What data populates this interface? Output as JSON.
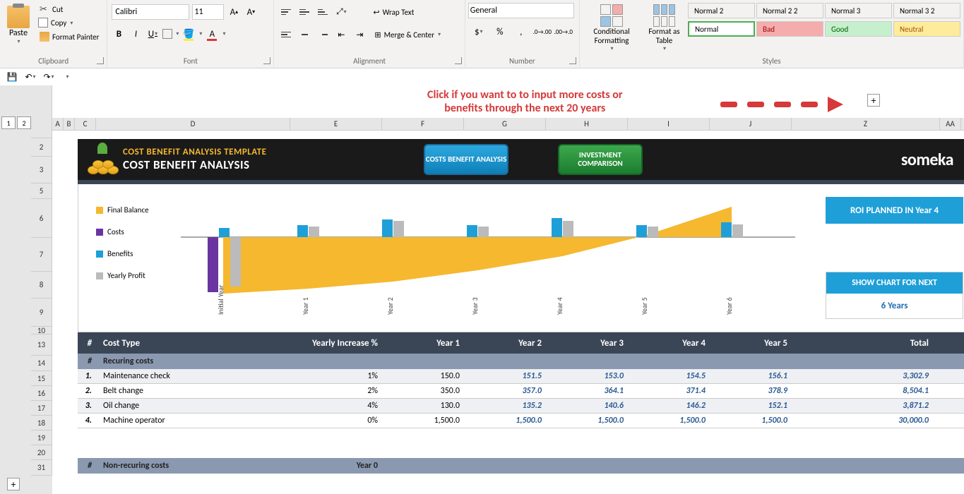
{
  "ribbon": {
    "clipboard": {
      "label": "Clipboard",
      "paste": "Paste",
      "cut": "Cut",
      "copy": "Copy",
      "format_painter": "Format Painter"
    },
    "font": {
      "label": "Font",
      "name": "Calibri",
      "size": "11"
    },
    "alignment": {
      "label": "Alignment",
      "wrap": "Wrap Text",
      "merge": "Merge & Center"
    },
    "number": {
      "label": "Number",
      "format": "General"
    },
    "styles": {
      "label": "Styles",
      "cond": "Conditional Formatting",
      "fat": "Format as Table",
      "normal2": "Normal 2",
      "normal22": "Normal 2 2",
      "normal3": "Normal 3",
      "normal32": "Normal 3 2",
      "normal": "Normal",
      "bad": "Bad",
      "good": "Good",
      "neutral": "Neutral"
    }
  },
  "annotation": {
    "line1": "Click if you want to to input more costs or",
    "line2": "benefits through the next 20 years"
  },
  "cols": [
    "A",
    "B",
    "C",
    "D",
    "E",
    "F",
    "G",
    "H",
    "I",
    "J",
    "Z",
    "AA"
  ],
  "rows": [
    "",
    "2",
    "3",
    "5",
    "6",
    "7",
    "8",
    "9",
    "10",
    "13",
    "14",
    "15",
    "16",
    "17",
    "18",
    "19",
    "20",
    "31"
  ],
  "title": {
    "yellow": "COST BENEFIT ANALYSIS TEMPLATE",
    "white": "COST BENEFIT ANALYSIS"
  },
  "buttons": {
    "cb": "COSTS BENEFIT ANALYSIS",
    "ic": "INVESTMENT COMPARISON"
  },
  "brand": "someka",
  "chart": {
    "legend": [
      "Final Balance",
      "Costs",
      "Benefits",
      "Yearly Profit"
    ],
    "roi": "ROI PLANNED IN Year 4",
    "next_label": "SHOW CHART FOR NEXT",
    "next_val": "6 Years",
    "xlabels": [
      "Initial Year",
      "Year 1",
      "Year 2",
      "Year 3",
      "Year 4",
      "Year 5",
      "Year 6"
    ]
  },
  "table": {
    "hdr": {
      "num": "#",
      "type": "Cost Type",
      "inc": "Yearly Increase %",
      "y1": "Year 1",
      "y2": "Year 2",
      "y3": "Year 3",
      "y4": "Year 4",
      "y5": "Year 5",
      "total": "Total"
    },
    "sub1": {
      "num": "#",
      "label": "Recuring costs"
    },
    "rows": [
      {
        "n": "1.",
        "type": "Maintenance check",
        "inc": "1%",
        "y1": "150.0",
        "y2": "151.5",
        "y3": "153.0",
        "y4": "154.5",
        "y5": "156.1",
        "total": "3,302.9"
      },
      {
        "n": "2.",
        "type": "Belt change",
        "inc": "2%",
        "y1": "350.0",
        "y2": "357.0",
        "y3": "364.1",
        "y4": "371.4",
        "y5": "378.9",
        "total": "8,504.1"
      },
      {
        "n": "3.",
        "type": "Oil change",
        "inc": "4%",
        "y1": "130.0",
        "y2": "135.2",
        "y3": "140.6",
        "y4": "146.2",
        "y5": "152.1",
        "total": "3,871.2"
      },
      {
        "n": "4.",
        "type": "Machine operator",
        "inc": "0%",
        "y1": "1,500.0",
        "y2": "1,500.0",
        "y3": "1,500.0",
        "y4": "1,500.0",
        "y5": "1,500.0",
        "total": "30,000.0"
      }
    ],
    "sub2": {
      "num": "#",
      "label": "Non-recuring costs",
      "y0": "Year 0"
    }
  },
  "chart_data": {
    "type": "bar",
    "title": "Cost Benefit Analysis",
    "categories": [
      "Initial Year",
      "Year 1",
      "Year 2",
      "Year 3",
      "Year 4",
      "Year 5",
      "Year 6"
    ],
    "series": [
      {
        "name": "Final Balance",
        "type": "area",
        "values": [
          -2000,
          -1800,
          -1500,
          -1100,
          -600,
          100,
          1100
        ]
      },
      {
        "name": "Costs",
        "type": "bar",
        "values": [
          2200,
          0,
          0,
          0,
          0,
          0,
          0
        ]
      },
      {
        "name": "Benefits",
        "type": "bar",
        "values": [
          300,
          400,
          500,
          400,
          600,
          400,
          450
        ]
      },
      {
        "name": "Yearly Profit",
        "type": "bar",
        "values": [
          -1900,
          350,
          450,
          350,
          500,
          350,
          400
        ]
      }
    ],
    "ylim": [
      -2500,
      1200
    ]
  }
}
